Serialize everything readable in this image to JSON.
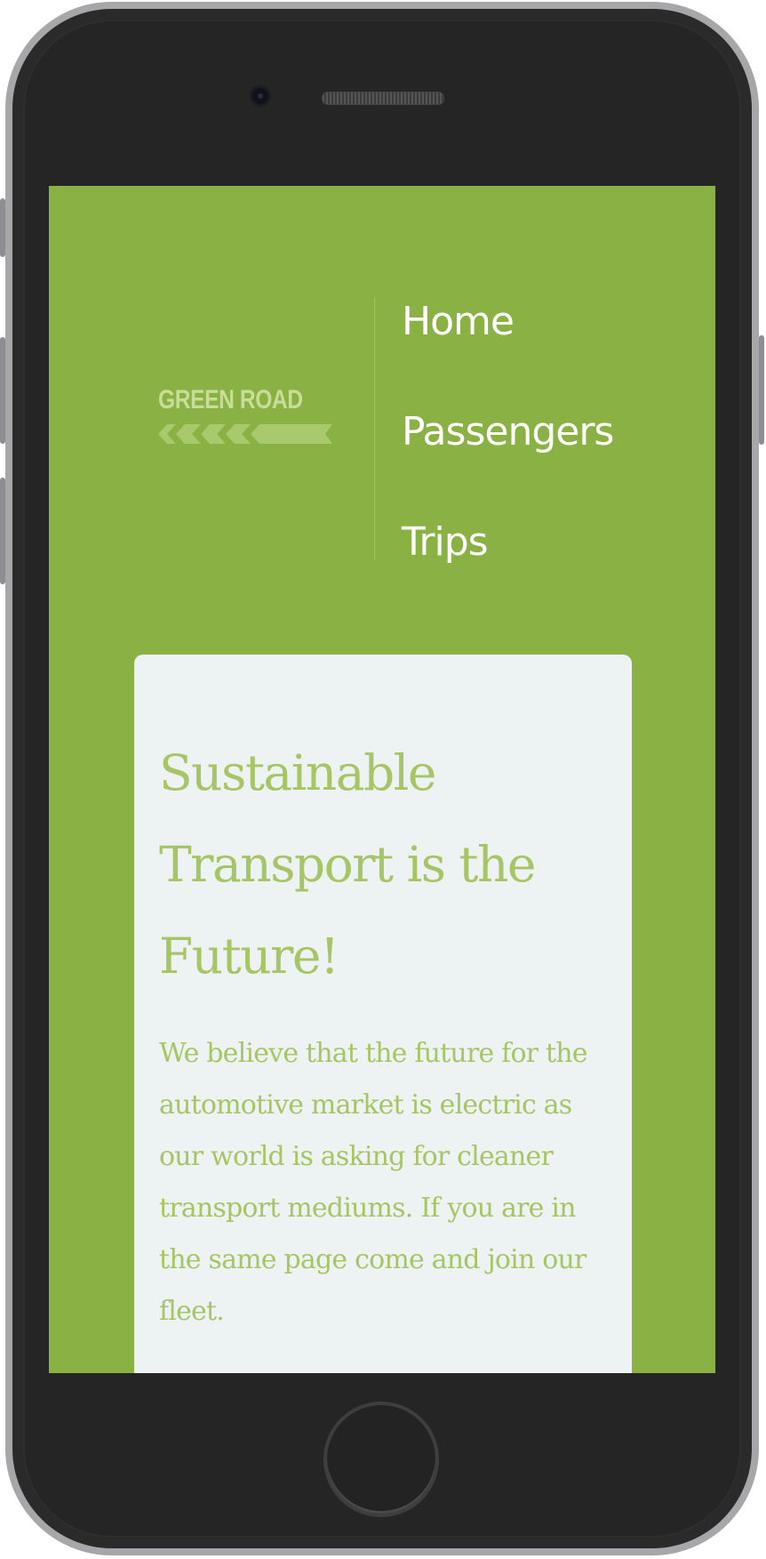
{
  "brand": {
    "logo_text": "GREEN ROAD"
  },
  "nav": {
    "items": [
      {
        "label": "Home"
      },
      {
        "label": "Passengers"
      },
      {
        "label": "Trips"
      }
    ]
  },
  "hero": {
    "title": "Sustainable Transport is the Future!",
    "body": "We believe that the future for the automotive market is electric as our world is asking for cleaner transport mediums. If you are in the same page come and join our fleet."
  },
  "colors": {
    "screen_background": "#8ab143",
    "card_background": "#edf2f3",
    "accent_text": "#a6c564",
    "logo": "#c8dd97",
    "nav_text": "#ffffff"
  },
  "icons": {
    "logo_mark": "chevron-road-icon",
    "camera": "camera-icon",
    "speaker": "speaker-icon"
  }
}
